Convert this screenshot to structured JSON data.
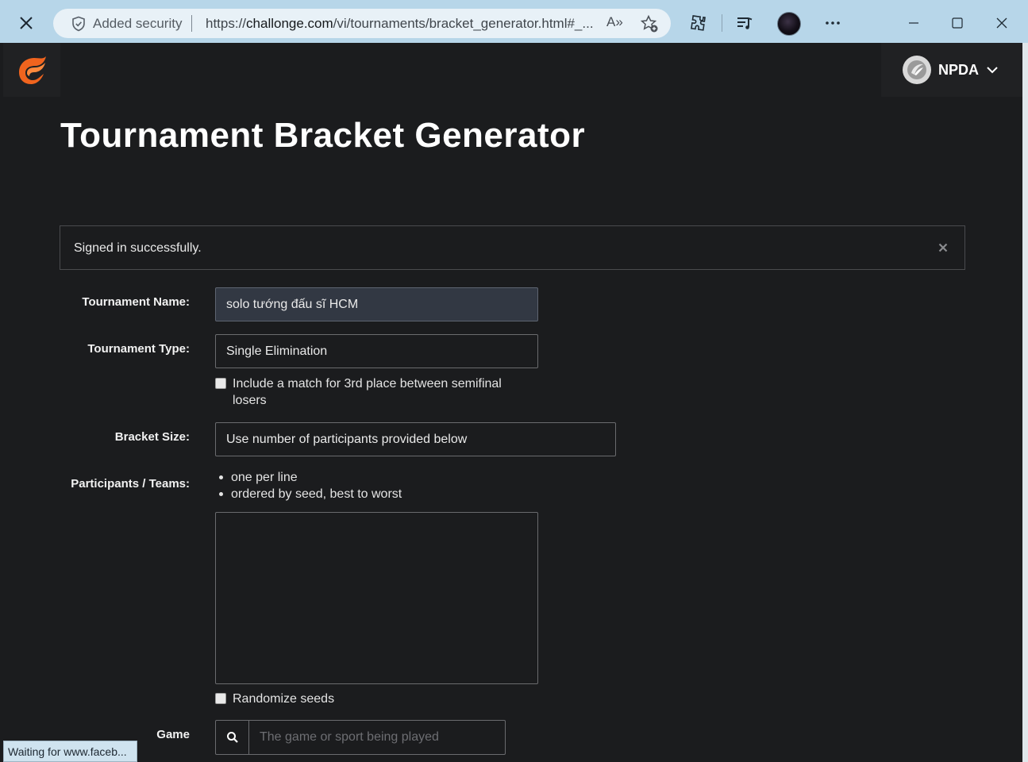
{
  "browser": {
    "security_label": "Added security",
    "url": "https://challonge.com/vi/tournaments/bracket_generator.html#_...",
    "url_host": "challonge.com",
    "url_prefix": "https://",
    "url_path": "/vi/tournaments/bracket_generator.html#_...",
    "read_aloud": "A»",
    "status_text": "Waiting for www.faceb..."
  },
  "header": {
    "username": "NPDA",
    "brand_color": "#f0641e"
  },
  "page": {
    "title": "Tournament Bracket Generator"
  },
  "alert": {
    "message": "Signed in successfully.",
    "close": "×"
  },
  "form": {
    "name_label": "Tournament Name:",
    "name_value": "solo tướng đấu sĩ HCM",
    "type_label": "Tournament Type:",
    "type_value": "Single Elimination",
    "third_place_label": "Include a match for 3rd place between semifinal losers",
    "third_place_line1": "Include a match for 3rd place between semifinal",
    "third_place_line2": "losers",
    "size_label": "Bracket Size:",
    "size_value": "Use number of participants provided below",
    "participants_label": "Participants / Teams:",
    "participants_hints": [
      "one per line",
      "ordered by seed, best to worst"
    ],
    "participants_value": "",
    "randomize_label": "Randomize seeds",
    "game_label": "Game",
    "game_placeholder": "The game or sport being played"
  }
}
